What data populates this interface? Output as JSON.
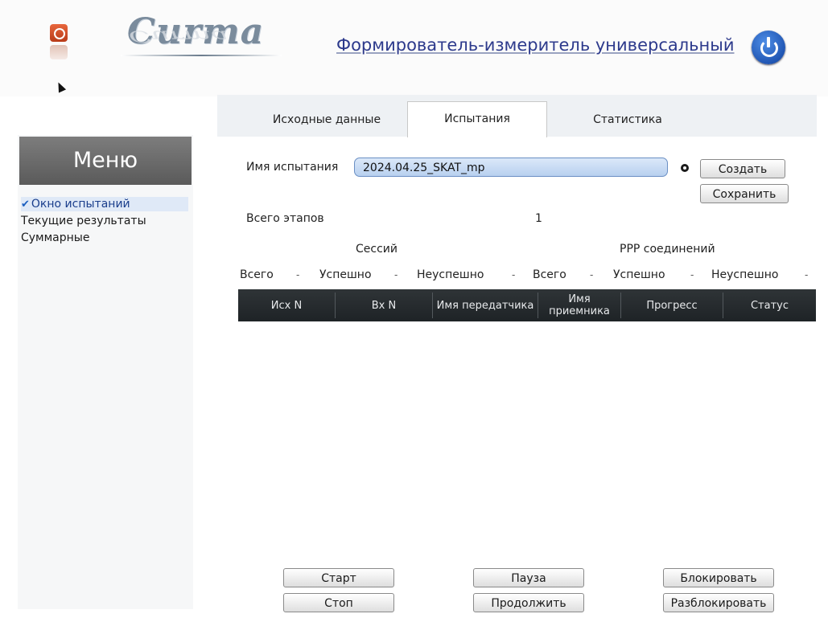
{
  "header": {
    "logo_text": "Curma",
    "device_title": "Формирователь-измеритель универсальный",
    "power_icon": "power-icon"
  },
  "tabs": [
    {
      "label": "Исходные данные",
      "active": false
    },
    {
      "label": "Испытания",
      "active": true
    },
    {
      "label": "Статистика",
      "active": false
    }
  ],
  "sidebar": {
    "title": "Меню",
    "items": [
      {
        "label": "Окно испытаний",
        "selected": true
      },
      {
        "label": "Текущие результаты",
        "selected": false
      },
      {
        "label": "Суммарные",
        "selected": false
      }
    ]
  },
  "test_form": {
    "name_label": "Имя испытания",
    "name_value": "2024.04.25_SKAT_mp",
    "create_label": "Создать",
    "save_label": "Сохранить",
    "total_stages_label": "Всего этапов",
    "total_stages_value": "1"
  },
  "stats": {
    "sessions_label": "Сессий",
    "ppp_label": "PPP соединений",
    "sessions": {
      "total": "Всего",
      "success": "Успешно",
      "fail": "Неуспешно"
    },
    "ppp": {
      "total": "Всего",
      "success": "Успешно",
      "fail": "Неуспешно"
    },
    "separator": "-"
  },
  "grid": {
    "columns": [
      "Исх N",
      "Вх N",
      "Имя передатчика",
      "Имя приемника",
      "Прогресс",
      "Статус"
    ],
    "rows": []
  },
  "controls": {
    "start_label": "Старт",
    "stop_label": "Стоп",
    "pause_label": "Пауза",
    "resume_label": "Продолжить",
    "block_label": "Блокировать",
    "unblock_label": "Разблокировать"
  },
  "colors": {
    "accent": "#2d3a8c",
    "selection": "#dfe9f7",
    "grid_header": "#24292c"
  }
}
